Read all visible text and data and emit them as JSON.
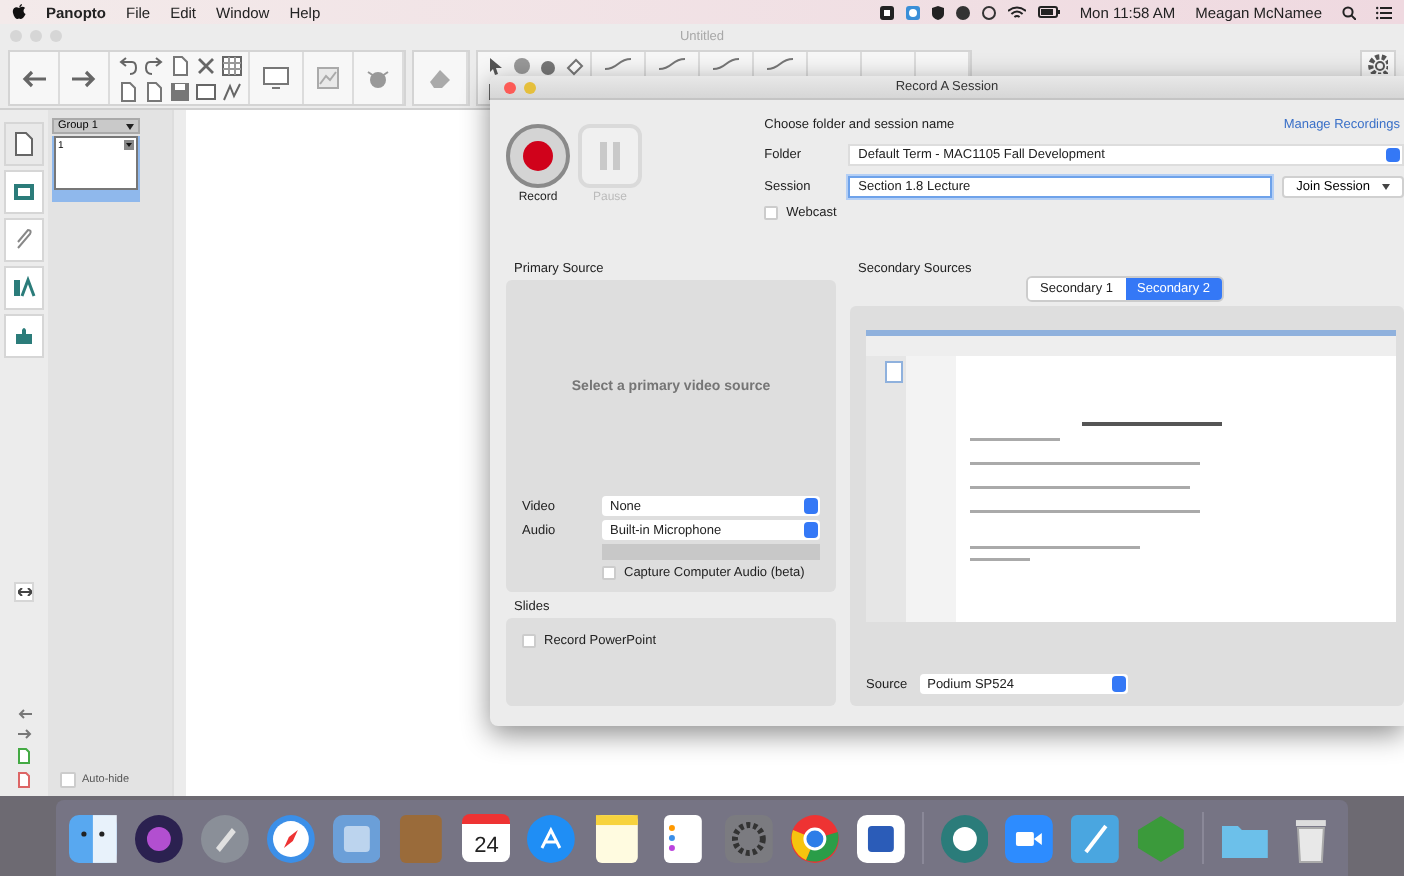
{
  "menubar": {
    "app": "Panopto",
    "menus": [
      "File",
      "Edit",
      "Window",
      "Help"
    ],
    "clock": "Mon 11:58 AM",
    "user": "Meagan McNamee"
  },
  "app_window": {
    "title": "Untitled",
    "sidebar_tabs": [
      {
        "selected": true
      },
      {
        "selected": false
      },
      {
        "selected": false
      },
      {
        "selected": false
      },
      {
        "selected": false
      }
    ],
    "group_select": "Group 1",
    "slide_thumbnail": {
      "number": "1",
      "selected": true
    },
    "auto_hide": {
      "label": "Auto-hide",
      "checked": false
    }
  },
  "dialog": {
    "title": "Record A Session",
    "record": {
      "label": "Record"
    },
    "pause": {
      "label": "Pause",
      "disabled": true
    },
    "heading": "Choose folder and session name",
    "manage_link": "Manage Recordings",
    "folder": {
      "label": "Folder",
      "value": "Default Term - MAC1105 Fall Development"
    },
    "session": {
      "label": "Session",
      "value": "Section 1.8 Lecture",
      "focused": true
    },
    "join_button": "Join Session",
    "webcast": {
      "label": "Webcast",
      "checked": false
    },
    "primary_source": {
      "title": "Primary Source",
      "message": "Select a primary video source",
      "video": {
        "label": "Video",
        "value": "None"
      },
      "audio": {
        "label": "Audio",
        "value": "Built-in Microphone"
      },
      "capture_audio": {
        "label": "Capture Computer Audio (beta)",
        "checked": false
      }
    },
    "slides": {
      "title": "Slides",
      "record_powerpoint": {
        "label": "Record PowerPoint",
        "checked": false
      }
    },
    "secondary_sources": {
      "title": "Secondary Sources",
      "tabs": [
        {
          "label": "Secondary 1",
          "selected": false
        },
        {
          "label": "Secondary 2",
          "selected": true
        }
      ],
      "source": {
        "label": "Source",
        "value": "Podium SP524"
      }
    }
  },
  "dock": {
    "calendar_day": "24"
  }
}
